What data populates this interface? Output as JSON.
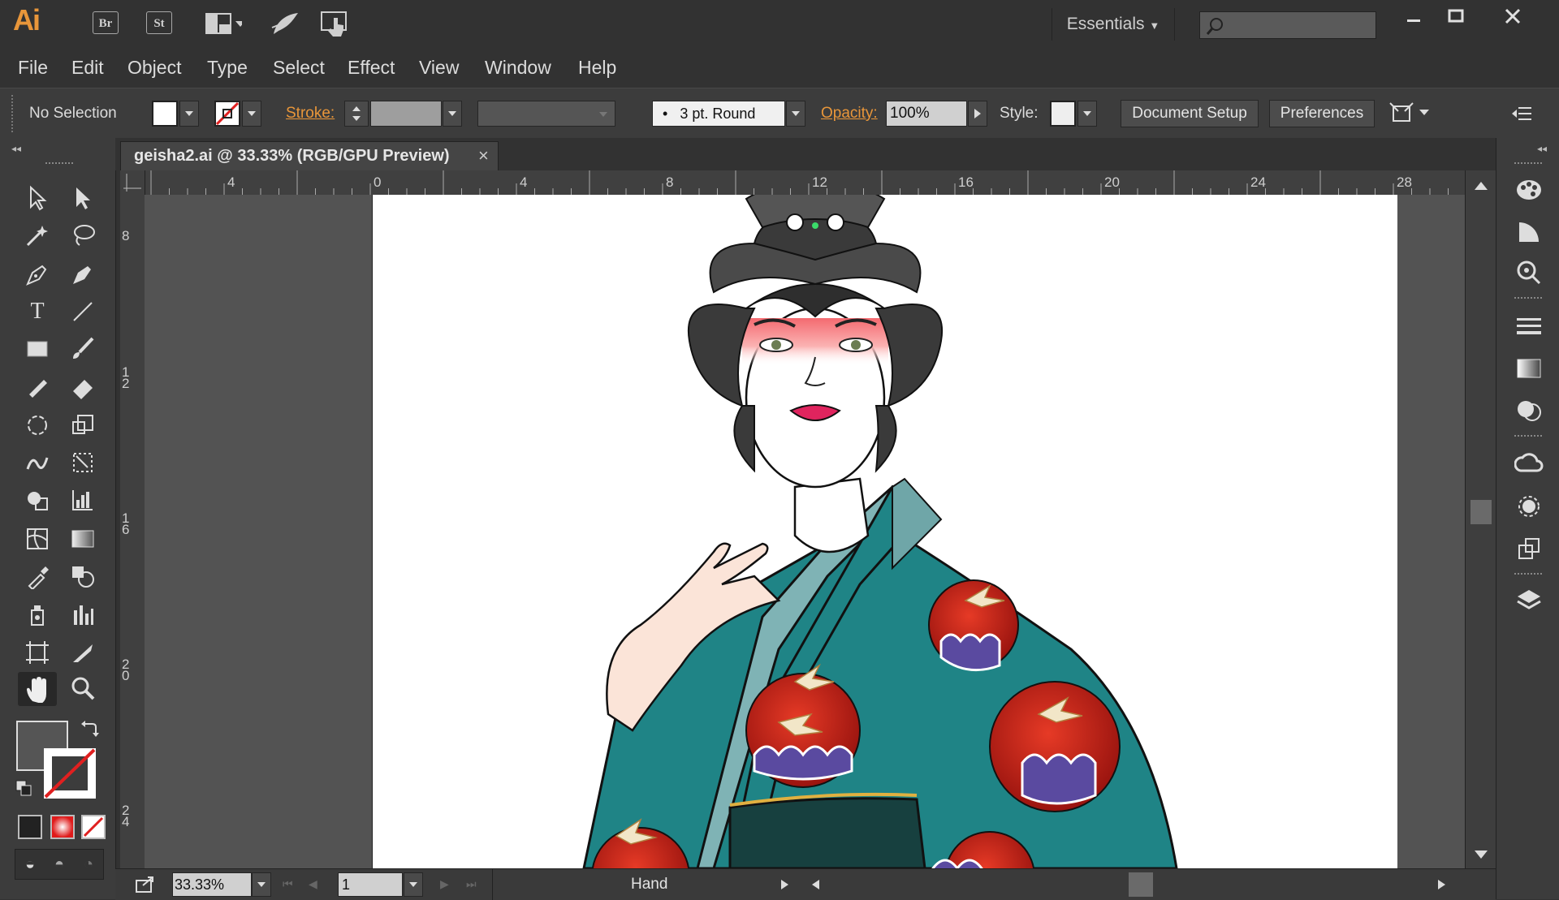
{
  "app": {
    "logo": "Ai",
    "bridge": "Br",
    "stock": "St"
  },
  "workspace": {
    "label": "Essentials"
  },
  "menu": [
    "File",
    "Edit",
    "Object",
    "Type",
    "Select",
    "Effect",
    "View",
    "Window",
    "Help"
  ],
  "control": {
    "selection_label": "No Selection",
    "stroke_label": "Stroke:",
    "brush_value": "3 pt. Round",
    "opacity_label": "Opacity:",
    "opacity_value": "100%",
    "style_label": "Style:",
    "doc_setup": "Document Setup",
    "preferences": "Preferences"
  },
  "document": {
    "tab_title": "geisha2.ai @ 33.33% (RGB/GPU Preview)",
    "close": "×"
  },
  "ruler": {
    "h_labels": [
      "4",
      "0",
      "4",
      "8",
      "12",
      "16",
      "20",
      "24",
      "28"
    ],
    "v_labels": [
      "8",
      "1\n2",
      "1\n6",
      "2\n0",
      "2\n4"
    ]
  },
  "status": {
    "zoom": "33.33%",
    "artboard": "1",
    "tool": "Hand"
  },
  "colors": {
    "accent": "#e8963a",
    "kimono": "#1f8486",
    "sun": "#c4201a",
    "hair": "#3a3a3a"
  },
  "icons": [
    "select-icon",
    "direct-select-icon",
    "magic-wand-icon",
    "lasso-icon",
    "pen-icon",
    "curvature-icon",
    "type-icon",
    "line-icon",
    "rectangle-icon",
    "paintbrush-icon",
    "pencil-icon",
    "eraser-icon",
    "rotate-icon",
    "scale-icon",
    "warp-icon",
    "free-transform-icon",
    "shape-builder-icon",
    "chart-icon",
    "mesh-icon",
    "gradient-icon",
    "eyedropper-icon",
    "blend-icon",
    "symbol-sprayer-icon",
    "column-graph-icon",
    "artboard-icon",
    "slice-icon",
    "hand-icon",
    "zoom-icon"
  ]
}
